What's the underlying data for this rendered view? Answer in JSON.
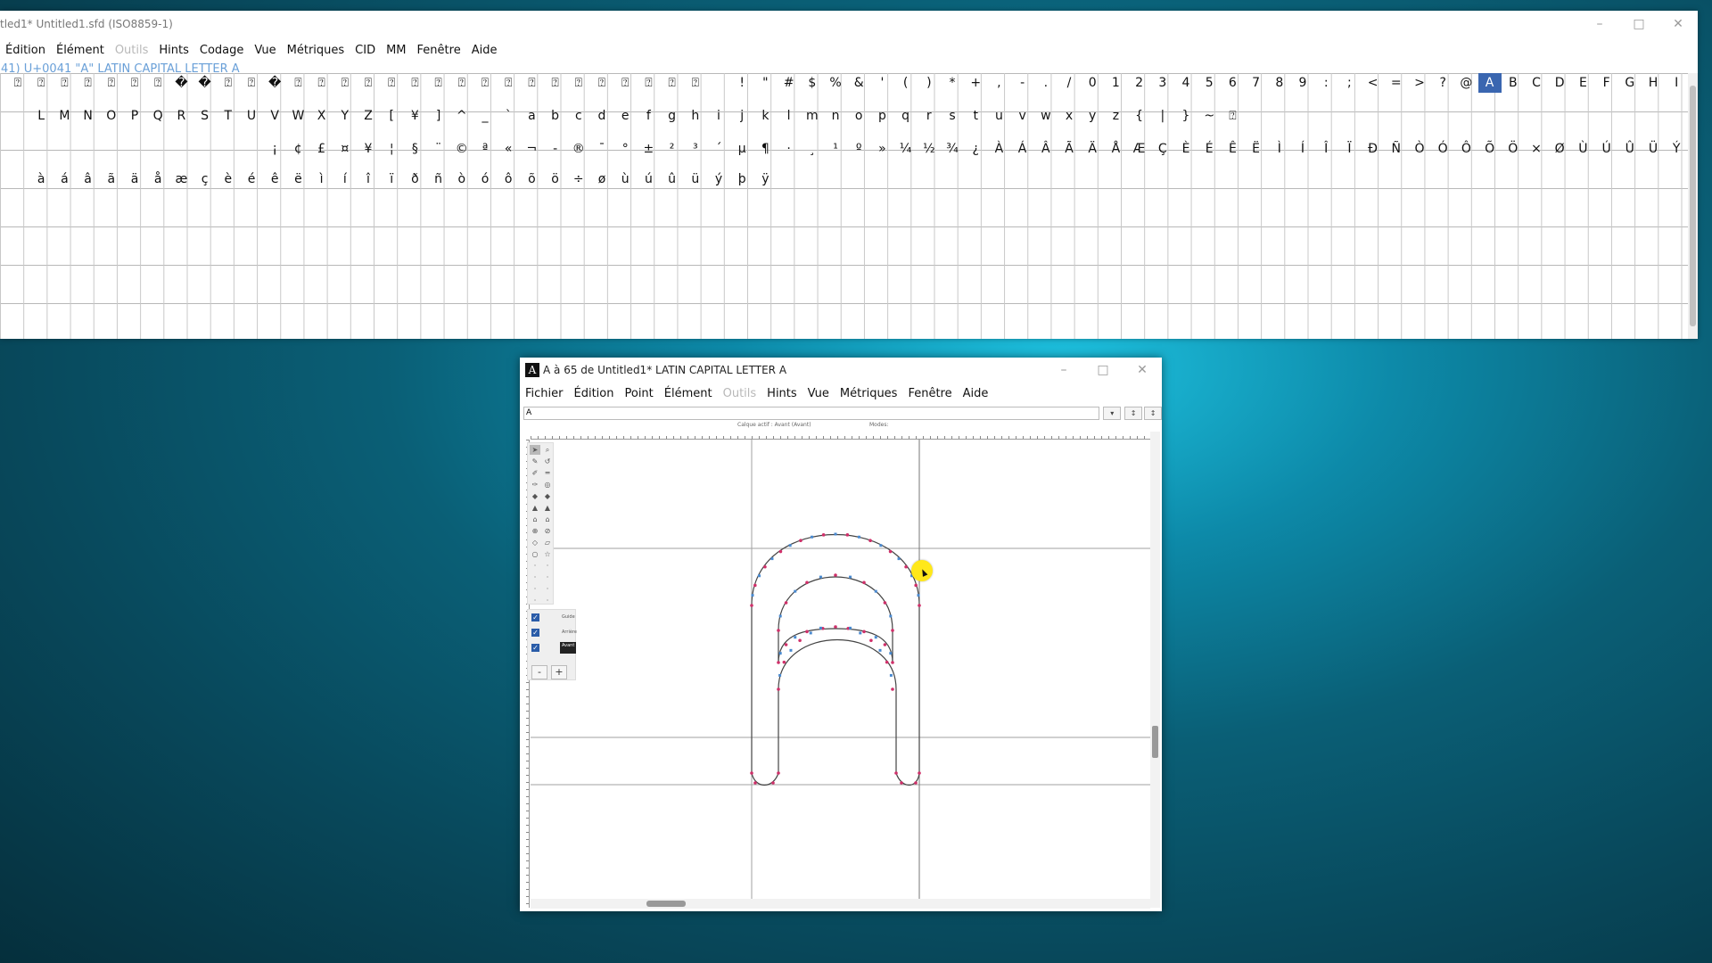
{
  "font_view": {
    "title": "tled1* Untitled1.sfd (ISO8859-1)",
    "menu": [
      {
        "label": "Édition",
        "disabled": false
      },
      {
        "label": "Élément",
        "disabled": false
      },
      {
        "label": "Outils",
        "disabled": true
      },
      {
        "label": "Hints",
        "disabled": false
      },
      {
        "label": "Codage",
        "disabled": false
      },
      {
        "label": "Vue",
        "disabled": false
      },
      {
        "label": "Métriques",
        "disabled": false
      },
      {
        "label": "CID",
        "disabled": false
      },
      {
        "label": "MM",
        "disabled": false
      },
      {
        "label": "Fenêtre",
        "disabled": false
      },
      {
        "label": "Aide",
        "disabled": false
      }
    ],
    "status": "41) U+0041 \"A\" LATIN CAPITAL LETTER A",
    "rows": [
      [
        "⍰",
        "⍰",
        "⍰",
        "⍰",
        "⍰",
        "⍰",
        "⍰",
        "�",
        "�",
        "⍰",
        "⍰",
        "�",
        "⍰",
        "⍰",
        "⍰",
        "⍰",
        "⍰",
        "⍰",
        "⍰",
        "⍰",
        "⍰",
        "⍰",
        "⍰",
        "⍰",
        "⍰",
        "⍰",
        "⍰",
        "⍰",
        "⍰",
        "⍰",
        "",
        "!",
        "\"",
        "#",
        "$",
        "%",
        "&",
        "'",
        "(",
        ")",
        "*",
        "+",
        ",",
        "-",
        ".",
        "/",
        "0",
        "1",
        "2",
        "3",
        "4",
        "5",
        "6",
        "7",
        "8",
        "9",
        ":",
        ";",
        "<",
        "=",
        ">",
        "?",
        "@",
        "A",
        "B",
        "C",
        "D",
        "E",
        "F",
        "G",
        "H",
        "I"
      ],
      [
        "",
        "L",
        "M",
        "N",
        "O",
        "P",
        "Q",
        "R",
        "S",
        "T",
        "U",
        "V",
        "W",
        "X",
        "Y",
        "Z",
        "[",
        "¥",
        "]",
        "^",
        "_",
        "`",
        "a",
        "b",
        "c",
        "d",
        "e",
        "f",
        "g",
        "h",
        "i",
        "j",
        "k",
        "l",
        "m",
        "n",
        "o",
        "p",
        "q",
        "r",
        "s",
        "t",
        "u",
        "v",
        "w",
        "x",
        "y",
        "z",
        "{",
        "|",
        "}",
        "~",
        "⍰"
      ],
      [
        "",
        "",
        "",
        "",
        "",
        "",
        "",
        "",
        "",
        "",
        "",
        "¡",
        "¢",
        "£",
        "¤",
        "¥",
        "¦",
        "§",
        "¨",
        "©",
        "ª",
        "«",
        "¬",
        "-",
        "®",
        "¯",
        "°",
        "±",
        "²",
        "³",
        "´",
        "µ",
        "¶",
        "·",
        "¸",
        "¹",
        "º",
        "»",
        "¼",
        "½",
        "¾",
        "¿",
        "À",
        "Á",
        "Â",
        "Ã",
        "Ä",
        "Å",
        "Æ",
        "Ç",
        "È",
        "É",
        "Ê",
        "Ë",
        "Ì",
        "Í",
        "Î",
        "Ï",
        "Ð",
        "Ñ",
        "Ò",
        "Ó",
        "Ô",
        "Õ",
        "Ö",
        "×",
        "Ø",
        "Ù",
        "Ú",
        "Û",
        "Ü",
        "Ý"
      ],
      [
        "",
        "à",
        "á",
        "â",
        "ã",
        "ä",
        "å",
        "æ",
        "ç",
        "è",
        "é",
        "ê",
        "ë",
        "ì",
        "í",
        "î",
        "ï",
        "ð",
        "ñ",
        "ò",
        "ó",
        "ô",
        "õ",
        "ö",
        "÷",
        "ø",
        "ù",
        "ú",
        "û",
        "ü",
        "ý",
        "þ",
        "ÿ"
      ]
    ],
    "selected_glyph": "A"
  },
  "glyph_window": {
    "title": "A à 65 de Untitled1* LATIN CAPITAL LETTER A",
    "app_icon": "A",
    "menu": [
      {
        "label": "Fichier",
        "disabled": false
      },
      {
        "label": "Édition",
        "disabled": false
      },
      {
        "label": "Point",
        "disabled": false
      },
      {
        "label": "Élément",
        "disabled": false
      },
      {
        "label": "Outils",
        "disabled": true
      },
      {
        "label": "Hints",
        "disabled": false
      },
      {
        "label": "Vue",
        "disabled": false
      },
      {
        "label": "Métriques",
        "disabled": false
      },
      {
        "label": "Fenêtre",
        "disabled": false
      },
      {
        "label": "Aide",
        "disabled": false
      }
    ],
    "glyph_name_value": "A",
    "info_layer": "Calque actif : Avant (Avant)",
    "info_modes": "Modes:",
    "layers": [
      {
        "checked": true,
        "label": "Guide"
      },
      {
        "checked": true,
        "label": "Arrière"
      },
      {
        "checked": true,
        "label": "Avant"
      }
    ],
    "minus_label": "-",
    "plus_label": "+",
    "colors": {
      "on_curve": "#d0306a",
      "off_curve": "#4a8ad0",
      "outline": "#444444",
      "guide": "#9a9a9a"
    }
  },
  "window_controls": {
    "minimize": "–",
    "maximize": "□",
    "close": "✕"
  }
}
